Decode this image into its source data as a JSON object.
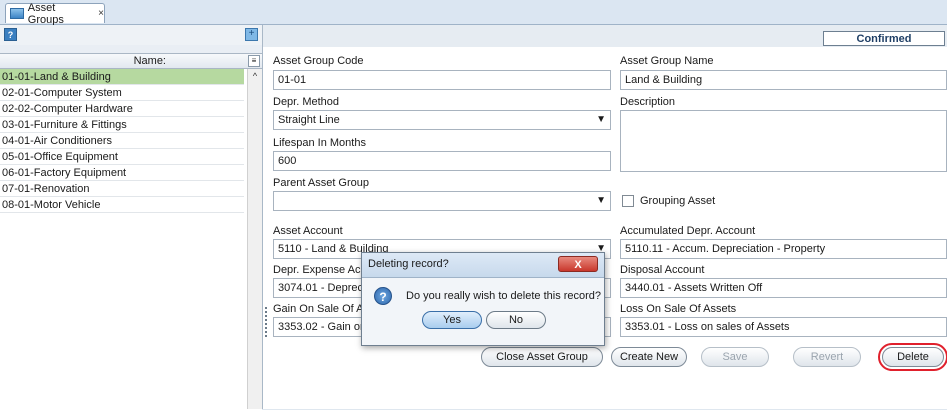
{
  "tab": {
    "label": "Asset Groups",
    "close": "×"
  },
  "left": {
    "help_icon": "?",
    "column_header": "Name:",
    "items": [
      "01-01-Land & Building",
      "02-01-Computer System",
      "02-02-Computer Hardware",
      "03-01-Furniture & Fittings",
      "04-01-Air Conditioners",
      "05-01-Office Equipment",
      "06-01-Factory Equipment",
      "07-01-Renovation",
      "08-01-Motor Vehicle"
    ],
    "selected_index": 0
  },
  "status": "Confirmed",
  "form": {
    "asset_group_code_label": "Asset Group Code",
    "asset_group_code": "01-01",
    "asset_group_name_label": "Asset Group Name",
    "asset_group_name": "Land & Building",
    "depr_method_label": "Depr. Method",
    "depr_method": "Straight Line",
    "description_label": "Description",
    "lifespan_label": "Lifespan In Months",
    "lifespan": "600",
    "parent_group_label": "Parent Asset Group",
    "parent_group": "",
    "grouping_asset_label": "Grouping Asset",
    "asset_account_label": "Asset Account",
    "asset_account": "5110 - Land & Building",
    "accum_depr_label": "Accumulated Depr. Account",
    "accum_depr": "5110.11 - Accum. Depreciation - Property",
    "depr_expense_label": "Depr. Expense Acco",
    "depr_expense": "3074.01 - Depreci",
    "disposal_label": "Disposal Account",
    "disposal": "3440.01 - Assets Written Off",
    "gain_label": "Gain On Sale Of As",
    "gain": "3353.02 - Gain on",
    "loss_label": "Loss On Sale Of Assets",
    "loss": "3353.01 - Loss on sales of Assets"
  },
  "buttons": {
    "close_group": "Close Asset Group",
    "create_new": "Create New",
    "save": "Save",
    "revert": "Revert",
    "delete": "Delete"
  },
  "dialog": {
    "title": "Deleting record?",
    "close": "X",
    "message": "Do you really wish to delete this record?",
    "yes": "Yes",
    "no": "No"
  },
  "icons": [
    "tab-icon",
    "help-icon",
    "add-icon",
    "column-chooser-icon",
    "question-icon",
    "chevron-down-icon"
  ]
}
